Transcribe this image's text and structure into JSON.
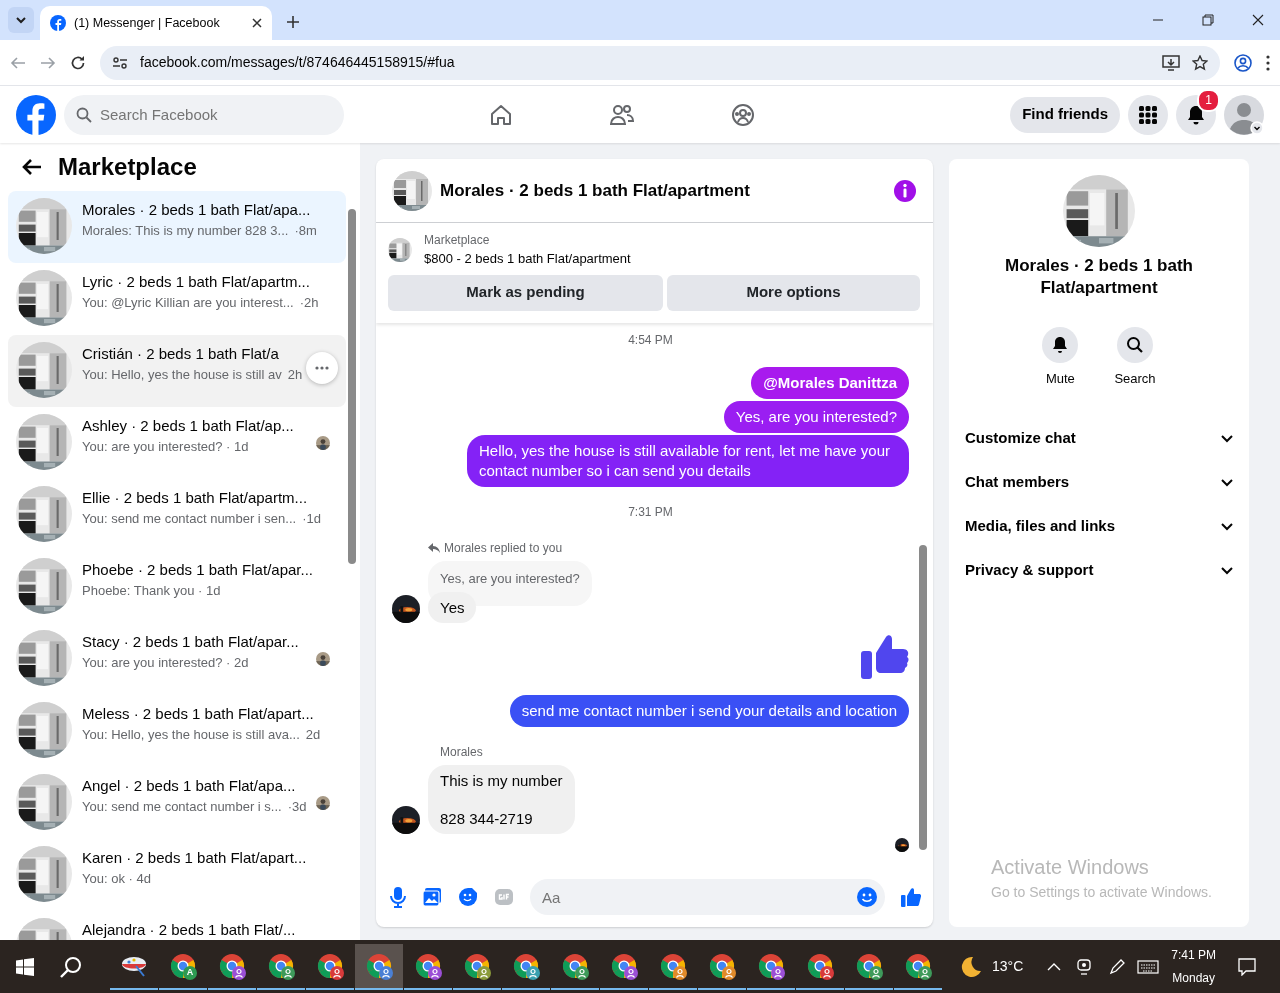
{
  "browser": {
    "tab_title": "(1) Messenger | Facebook",
    "url": "facebook.com/messages/t/874646445158915/#fua"
  },
  "header": {
    "search_placeholder": "Search Facebook",
    "find_friends": "Find friends",
    "notification_count": "1"
  },
  "sidebar": {
    "title": "Marketplace",
    "conversations": [
      {
        "title": "Morales · 2 beds 1 bath Flat/apa...",
        "preview": "Morales: This is my number 828 3...",
        "time": "·8m",
        "selected": true,
        "hovered": false,
        "seen": false
      },
      {
        "title": "Lyric · 2 beds 1 bath Flat/apartm...",
        "preview": "You: @Lyric Killian are you interest...",
        "time": "·2h",
        "selected": false,
        "hovered": false,
        "seen": false
      },
      {
        "title": "Cristián · 2 beds 1 bath Flat/a",
        "preview": "You: Hello, yes the house is still av",
        "time": "2h",
        "selected": false,
        "hovered": true,
        "seen": false
      },
      {
        "title": "Ashley · 2 beds 1 bath Flat/ap...",
        "preview": "You: are you interested? · 1d",
        "selected": false,
        "hovered": false,
        "seen": true
      },
      {
        "title": "Ellie · 2 beds 1 bath Flat/apartm...",
        "preview": "You: send me contact number i sen...",
        "time": "·1d",
        "selected": false,
        "hovered": false,
        "seen": false
      },
      {
        "title": "Phoebe · 2 beds 1 bath Flat/apar...",
        "preview": "Phoebe: Thank you · 1d",
        "selected": false,
        "hovered": false,
        "seen": false
      },
      {
        "title": "Stacy · 2 beds 1 bath Flat/apar...",
        "preview": "You: are you interested? · 2d",
        "selected": false,
        "hovered": false,
        "seen": true
      },
      {
        "title": "Meless · 2 beds 1 bath Flat/apart...",
        "preview": "You: Hello, yes the house is still ava...",
        "time": "2d",
        "selected": false,
        "hovered": false,
        "seen": false
      },
      {
        "title": "Angel · 2 beds 1 bath Flat/apa...",
        "preview": "You: send me contact number i s...",
        "time": "·3d",
        "selected": false,
        "hovered": false,
        "seen": true
      },
      {
        "title": "Karen · 2 beds 1 bath Flat/apart...",
        "preview": "You: ok · 4d",
        "selected": false,
        "hovered": false,
        "seen": false
      },
      {
        "title": "Alejandra · 2 beds 1 bath Flat/...",
        "selected": false,
        "hovered": false,
        "seen": false
      }
    ]
  },
  "chat": {
    "title": "Morales · 2 beds 1 bath Flat/apartment",
    "listing": {
      "label": "Marketplace",
      "text": "$800 - 2 beds 1 bath Flat/apartment"
    },
    "buttons": [
      "Mark as pending",
      "More options"
    ],
    "messages": [
      {
        "kind": "time",
        "text": "4:54 PM"
      },
      {
        "kind": "outgoing",
        "text": "@Morales Danittza",
        "bold": true,
        "color": "#a81aee"
      },
      {
        "kind": "outgoing",
        "text": "Yes, are you interested?",
        "bold": false,
        "color": "#9a1ef2"
      },
      {
        "kind": "outgoing",
        "text": "Hello, yes the house is still available for rent, let me have your contact number so i can send you details",
        "bold": false,
        "color": "#8422f6"
      },
      {
        "kind": "time",
        "text": "7:31 PM"
      },
      {
        "kind": "reply",
        "label": "Morales replied to you",
        "quote": "Yes, are you interested?",
        "text": "Yes"
      },
      {
        "kind": "like",
        "color": "#5046ee"
      },
      {
        "kind": "outgoing",
        "text": "send me contact number i send your details and location",
        "bold": false,
        "color": "#3a50f5"
      },
      {
        "kind": "incoming",
        "sender": "Morales",
        "text": "This is my number\n\n828 344-2719"
      },
      {
        "kind": "seen"
      }
    ],
    "composer": {
      "placeholder": "Aa"
    }
  },
  "details": {
    "title": "Morales · 2 beds 1 bath Flat/apartment",
    "actions": [
      "Mute",
      "Search"
    ],
    "sections": [
      {
        "label": "Customize chat",
        "expanded": false
      },
      {
        "label": "Chat members",
        "expanded": false
      },
      {
        "label": "Media, files and links",
        "expanded": false
      },
      {
        "label": "Privacy & support",
        "expanded": false
      }
    ]
  },
  "overlay": {
    "title": "Activate Windows",
    "text": "Go to Settings to activate Windows."
  },
  "taskbar": {
    "apps": [
      {
        "kind": "paint",
        "selected": false
      },
      {
        "kind": "chrome",
        "color": "#2e9a52",
        "label": "A",
        "selected": false
      },
      {
        "kind": "chrome",
        "color": "#9b4fd6",
        "selected": false
      },
      {
        "kind": "chrome",
        "color": "#3e9a5a",
        "selected": false
      },
      {
        "kind": "chrome",
        "color": "#d83a3a",
        "selected": false
      },
      {
        "kind": "chrome",
        "color": "#4a7fd4",
        "selected": true
      },
      {
        "kind": "chrome",
        "color": "#9b4fd6",
        "selected": false
      },
      {
        "kind": "chrome",
        "color": "#8a9a3a",
        "selected": false
      },
      {
        "kind": "chrome",
        "color": "#3aa0b0",
        "selected": false
      },
      {
        "kind": "chrome",
        "color": "#3e9a5a",
        "selected": false
      },
      {
        "kind": "chrome",
        "color": "#9b4fd6",
        "selected": false
      },
      {
        "kind": "chrome",
        "color": "#e08a2a",
        "selected": false
      },
      {
        "kind": "chrome",
        "color": "#e08a2a",
        "selected": false
      },
      {
        "kind": "chrome",
        "color": "#9b4fd6",
        "selected": false
      },
      {
        "kind": "chrome",
        "color": "#d83a3a",
        "selected": false
      },
      {
        "kind": "chrome",
        "color": "#3e9a5a",
        "selected": false
      },
      {
        "kind": "chrome",
        "color": "#3e9a5a",
        "selected": false
      }
    ],
    "weather": "13°C",
    "time": "7:41 PM",
    "day": "Monday"
  }
}
